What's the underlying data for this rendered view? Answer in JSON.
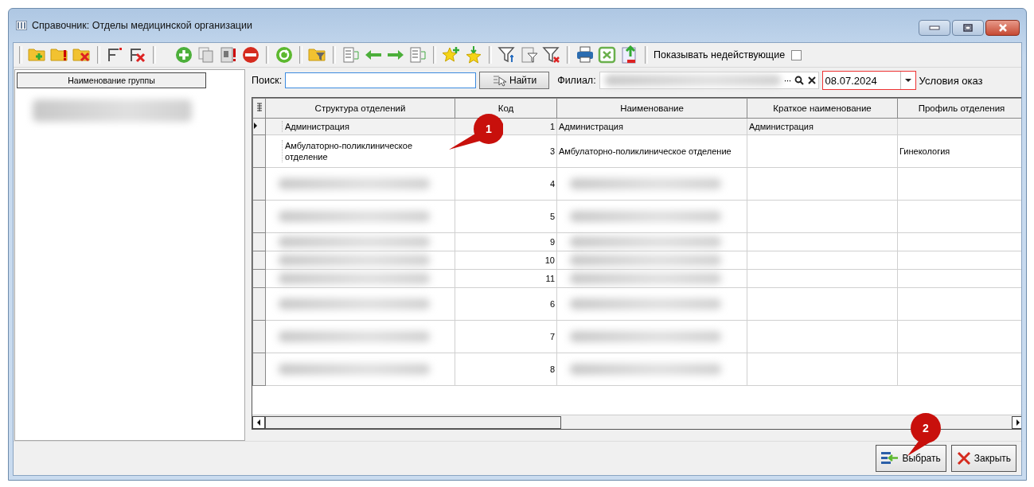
{
  "window": {
    "title": "Справочник: Отделы медицинской организации"
  },
  "toolbar": {
    "show_inactive": {
      "label": "Показывать недействующие",
      "checked": false
    }
  },
  "group_list": {
    "header": "Наименование группы",
    "items": [
      {
        "kind": "redacted"
      }
    ]
  },
  "search": {
    "label": "Поиск:",
    "button": "Найти"
  },
  "branch": {
    "label": "Филиал:",
    "kind": "redacted",
    "more": "···"
  },
  "date": {
    "value": "08.07.2024"
  },
  "conditions_label": "Условия оказ",
  "table": {
    "columns": [
      "Структура отделений",
      "Код",
      "Наименование",
      "Краткое наименование",
      "Профиль отделения"
    ],
    "rows": [
      {
        "selected": true,
        "redacted": false,
        "tall": false,
        "structure": "Администрация",
        "code": "1",
        "name": "Администрация",
        "short": "Администрация"
      },
      {
        "selected": false,
        "redacted": false,
        "tall": true,
        "structure": "Амбулаторно-поликлиническое отделение",
        "code": "3",
        "name": "Амбулаторно-поликлиническое отделение",
        "profile": "Гинекология"
      },
      {
        "selected": false,
        "redacted": true,
        "tall": true,
        "code": "4"
      },
      {
        "selected": false,
        "redacted": true,
        "tall": true,
        "code": "5"
      },
      {
        "selected": false,
        "redacted": true,
        "tall": false,
        "code": "9"
      },
      {
        "selected": false,
        "redacted": true,
        "tall": false,
        "code": "10"
      },
      {
        "selected": false,
        "redacted": true,
        "tall": false,
        "code": "11"
      },
      {
        "selected": false,
        "redacted": true,
        "tall": true,
        "code": "6"
      },
      {
        "selected": false,
        "redacted": true,
        "tall": true,
        "code": "7"
      },
      {
        "selected": false,
        "redacted": true,
        "tall": true,
        "code": "8"
      }
    ]
  },
  "buttons": [
    {
      "kind": "select",
      "label": "Выбрать"
    },
    {
      "kind": "close",
      "label": "Закрыть"
    }
  ],
  "callouts": [
    {
      "number": "1"
    },
    {
      "number": "2"
    }
  ]
}
